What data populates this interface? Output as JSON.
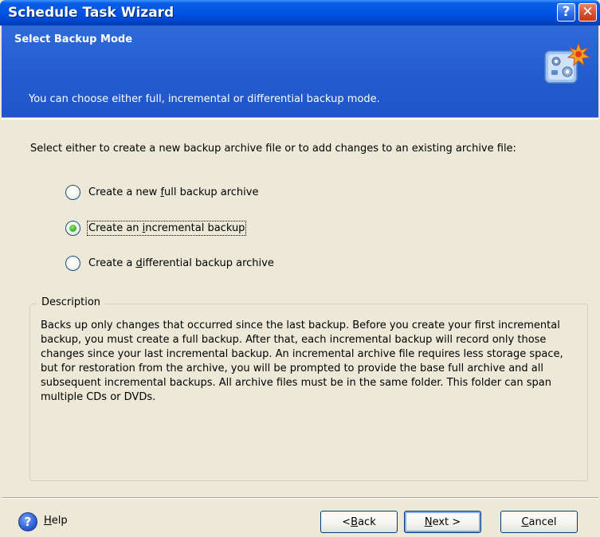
{
  "window": {
    "title": "Schedule Task Wizard",
    "help_button": "?",
    "close_button": "✕"
  },
  "header": {
    "title": "Select Backup Mode",
    "subtitle": "You can choose either full, incremental or differential backup mode.",
    "icon": "backup-wizard-icon"
  },
  "prompt": "Select either to create a new backup archive file or to add changes to an existing archive file:",
  "options": [
    {
      "pre": "Create a new ",
      "key": "f",
      "post": "ull backup archive",
      "checked": false
    },
    {
      "pre": "Create an ",
      "key": "i",
      "post": "ncremental backup",
      "checked": true
    },
    {
      "pre": "Create a ",
      "key": "d",
      "post": "ifferential backup archive",
      "checked": false
    }
  ],
  "description": {
    "legend": "Description",
    "text": "Backs up only changes that occurred since the last backup. Before you create your first incremental backup, you must create a full backup. After that, each incremental backup will record only those changes since your last incremental backup. An incremental archive file requires less storage space, but for restoration from the archive, you will be prompted to provide the base full archive and all subsequent incremental backups. All archive files must be in the same folder. This folder can span multiple CDs or DVDs."
  },
  "footer": {
    "help_key": "H",
    "help_rest": "elp",
    "back_pre": "< ",
    "back_key": "B",
    "back_rest": "ack",
    "next_key": "N",
    "next_rest": "ext >",
    "cancel_key": "C",
    "cancel_rest": "ancel"
  },
  "colors": {
    "title_bar": "#0055E5",
    "header_bg": "#245DD0",
    "dialog_bg": "#ECE9D8",
    "radio_checked": "#3DB52A"
  }
}
